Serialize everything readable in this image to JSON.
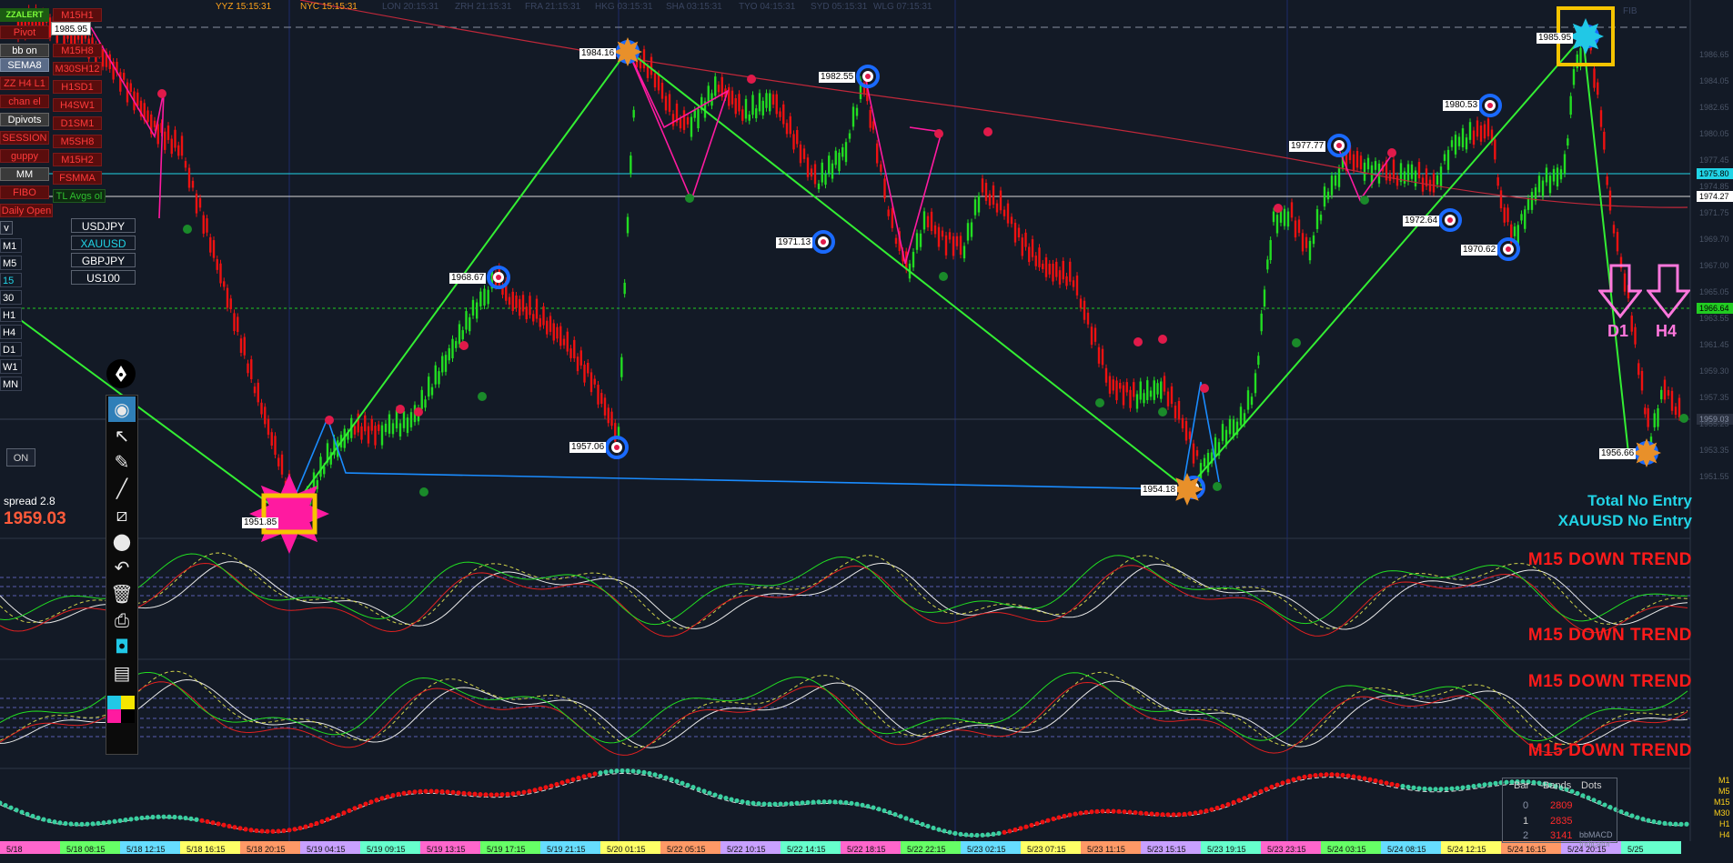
{
  "sessions": {
    "yyz": "YYZ 15:15:31",
    "nyc": "NYC 15:15:31",
    "lon": "LON 20:15:31",
    "zrh": "ZRH 21:15:31",
    "fra": "FRA 21:15:31",
    "hkg": "HKG 03:15:31",
    "sha": "SHA 03:15:31",
    "tyo": "TYO 04:15:31",
    "syd": "SYD 05:15:31",
    "wlg": "WLG 07:15:31",
    "fib": "FIB"
  },
  "panel": {
    "zzalert": "ZZALERT",
    "m15h1": "M15H1",
    "pivot": "Pivot",
    "bb_on": "bb on",
    "m15h8": "M15H8",
    "sema8": "SEMA8",
    "m30sh12": "M30SH12",
    "zz_h4_h1": "ZZ H4 L1",
    "h1sd1": "H1SD1",
    "channel": "chan el",
    "h4sw1": "H4SW1",
    "dpivots": "Dpivots",
    "d1sm1": "D1SM1",
    "session": "SESSION",
    "m5sh8": "M5SH8",
    "guppy": "guppy",
    "m15h2": "M15H2",
    "mm": "MM",
    "fsmma": "FSMMA",
    "fibo": "FIBO",
    "avgs": "TL Avgs ol",
    "daily_open": "Daily Open",
    "v": "v",
    "price_box": "1985.95"
  },
  "timeframes": [
    "M1",
    "M5",
    "15",
    "30",
    "H1",
    "H4",
    "D1",
    "W1",
    "MN"
  ],
  "symbols": [
    "USDJPY",
    "XAUUSD",
    "GBPJPY",
    "US100"
  ],
  "on_button": "ON",
  "spread_label": "spread 2.8",
  "bid_price": "1959.03",
  "entry_status": {
    "total": "Total No Entry",
    "symbol": "XAUUSD No Entry"
  },
  "trend_labels": [
    "M15 DOWN TREND",
    "M15 DOWN TREND",
    "M15 DOWN TREND",
    "M15 DOWN TREND"
  ],
  "arrows": {
    "d1": "D1",
    "h4": "H4"
  },
  "swing_labels": [
    "1985.95",
    "1984.16",
    "1982.55",
    "1980.53",
    "1977.77",
    "1971.13",
    "1972.64",
    "1970.62",
    "1968.67",
    "1957.06",
    "1954.18",
    "1951.85",
    "1956.66"
  ],
  "price_tags": {
    "cyan": "1975.80",
    "white": "1974.27",
    "green": "1966.64",
    "last": "1959.03"
  },
  "price_axis": [
    "1986.65",
    "1984.05",
    "1982.65",
    "1980.05",
    "1977.45",
    "1974.85",
    "1971.75",
    "1969.70",
    "1967.00",
    "1965.05",
    "1963.55",
    "1961.45",
    "1959.30",
    "1957.35",
    "1955.25",
    "1953.35",
    "1951.55"
  ],
  "bands_table": {
    "headers": [
      "Bar",
      "Bands",
      "Dots"
    ],
    "rows": [
      [
        "0",
        "2809",
        ""
      ],
      [
        "1",
        "2835",
        ""
      ],
      [
        "2",
        "3141",
        "bbMACD Indicator"
      ]
    ],
    "tf": [
      "M1",
      "M5",
      "M15",
      "M30",
      "H1",
      "H4"
    ]
  },
  "time_axis": [
    "5/18",
    "5/18 08:15",
    "5/18 12:15",
    "5/18 16:15",
    "5/18 20:15",
    "5/19 04:15",
    "5/19 09:15",
    "5/19 13:15",
    "5/19 17:15",
    "5/19 21:15",
    "5/20 01:15",
    "5/22 05:15",
    "5/22 10:15",
    "5/22 14:15",
    "5/22 18:15",
    "5/22 22:15",
    "5/23 02:15",
    "5/23 07:15",
    "5/23 11:15",
    "5/23 15:15",
    "5/23 19:15",
    "5/23 23:15",
    "5/24 03:15",
    "5/24 08:15",
    "5/24 12:15",
    "5/24 16:15",
    "5/24 20:15",
    "5/25"
  ],
  "colors": {
    "bull": "#22dd22",
    "bear": "#ee1111",
    "neutral": "#1a2aff",
    "zigzag": "#33ee33",
    "pink": "#ff1aa0",
    "cyan": "#21d4e6",
    "ma": "#c0283a"
  }
}
